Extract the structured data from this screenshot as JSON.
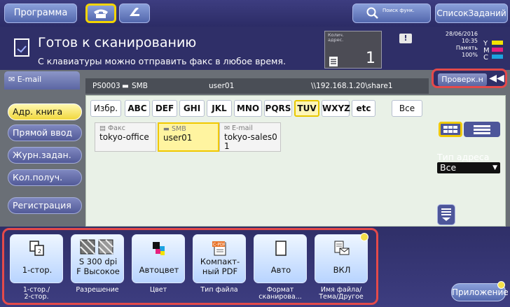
{
  "topbar": {
    "program": "Программа",
    "search": "Поиск функ.",
    "jobs": "СписокЗаданий"
  },
  "status": {
    "title": "Готов к сканированию",
    "message": "С клавиатуры можно отправить факс в любое время.",
    "counter_label": "Колич. адрес.",
    "counter_value": "1",
    "date": "28/06/2016",
    "time": "10:35",
    "memory": "Память",
    "memory_pct": "100%",
    "toner": [
      "Y",
      "M",
      "C"
    ]
  },
  "tab": {
    "email": "E-mail",
    "check": "Проверк.н"
  },
  "path": {
    "id": "PS0003",
    "type": "SMB",
    "user": "user01",
    "share": "\\\\192.168.1.20\\share1"
  },
  "nav": {
    "address_book": "Адр. книга",
    "direct_input": "Прямой ввод",
    "job_log": "Журн.задан.",
    "recipients": "Кол.получ.",
    "registration": "Регистрация"
  },
  "index": {
    "favorites": "Избр.",
    "tabs": [
      "ABC",
      "DEF",
      "GHI",
      "JKL",
      "MNO",
      "PQRS",
      "TUV",
      "WXYZ",
      "etc"
    ],
    "all": "Все"
  },
  "entries": [
    {
      "type": "Факс",
      "name": "tokyo-office"
    },
    {
      "type": "SMB",
      "name": "user01"
    },
    {
      "type": "E-mail",
      "name": "tokyo-sales01"
    }
  ],
  "address_type": {
    "label": "Тип адреса",
    "value": "Все"
  },
  "settings": [
    {
      "value": "1-стор.",
      "caption": "1-стор./ 2-стор."
    },
    {
      "value": "S 300 dpi F Высокое",
      "caption": "Разрешение"
    },
    {
      "value": "Автоцвет",
      "caption": "Цвет"
    },
    {
      "value": "Компакт-ный PDF",
      "caption": "Тип файла"
    },
    {
      "value": "Авто",
      "caption": "Формат сканирова..."
    },
    {
      "value": "ВКЛ",
      "caption": "Имя файла/ Тема/Другое"
    }
  ],
  "settings_values_split": {
    "res_line1": "S 300 dpi",
    "res_line2": "F Высокое",
    "pdf_line1": "Компакт-",
    "pdf_line2": "ный PDF",
    "cap_duplex_1": "1-стор./",
    "cap_duplex_2": "2-стор.",
    "cap_size_1": "Формат",
    "cap_size_2": "сканирова...",
    "cap_file_1": "Имя файла/",
    "cap_file_2": "Тема/Другое",
    "pdf_icon_text": "C-PDF"
  },
  "app": "Приложение"
}
